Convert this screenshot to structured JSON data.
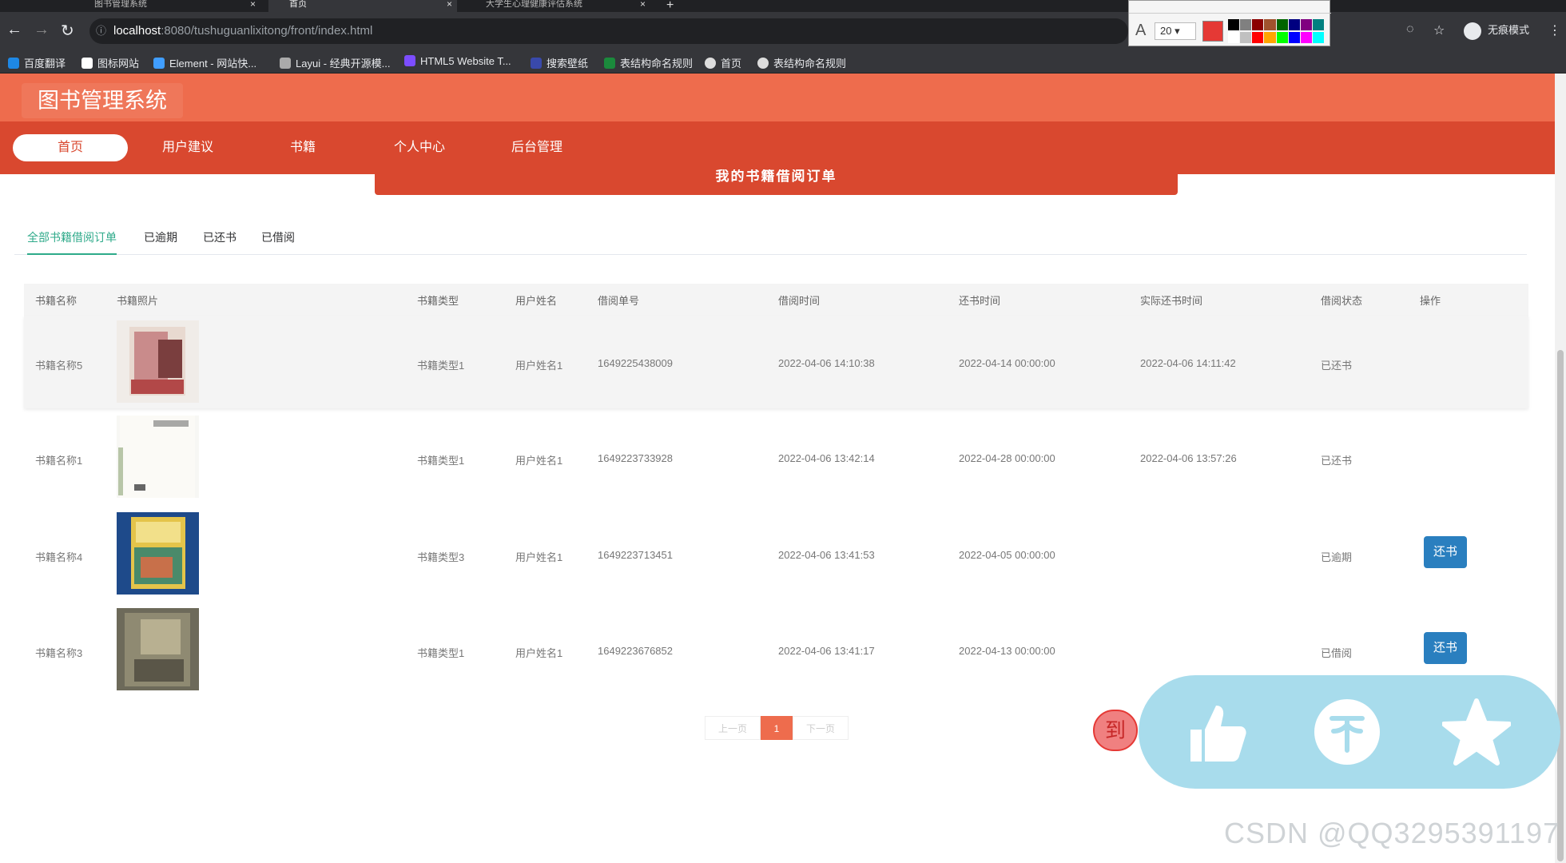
{
  "browser": {
    "tabs": [
      {
        "label": "图书管理系统",
        "active": false
      },
      {
        "label": "首页",
        "active": true
      },
      {
        "label": "大学生心理健康评估系统",
        "active": false
      }
    ],
    "url_host": "localhost",
    "url_path": ":8080/tushuguanlixitong/front/index.html",
    "incognito_label": "无痕模式",
    "font_size_value": "20",
    "bookmarks": [
      "百度翻译",
      "图标网站",
      "Element - 网站快...",
      "Layui - 经典开源模...",
      "HTML5 Website T...",
      "搜索壁纸",
      "表结构命名规则",
      "首页",
      "表结构命名规则"
    ]
  },
  "site": {
    "title": "图书管理系统",
    "nav": [
      "首页",
      "用户建议",
      "书籍",
      "个人中心",
      "后台管理"
    ],
    "active_nav": 0,
    "subtitle": "我的书籍借阅订单"
  },
  "order_tabs": [
    "全部书籍借阅订单",
    "已逾期",
    "已还书",
    "已借阅"
  ],
  "table": {
    "headers": [
      "书籍名称",
      "书籍照片",
      "书籍类型",
      "用户姓名",
      "借阅单号",
      "借阅时间",
      "还书时间",
      "实际还书时间",
      "借阅状态",
      "操作"
    ],
    "rows": [
      {
        "name": "书籍名称5",
        "type": "书籍类型1",
        "user": "用户姓名1",
        "order_no": "1649225438009",
        "borrow_time": "2022-04-06 14:10:38",
        "due_time": "2022-04-14 00:00:00",
        "actual_return": "2022-04-06 14:11:42",
        "status": "已还书",
        "action": ""
      },
      {
        "name": "书籍名称1",
        "type": "书籍类型1",
        "user": "用户姓名1",
        "order_no": "1649223733928",
        "borrow_time": "2022-04-06 13:42:14",
        "due_time": "2022-04-28 00:00:00",
        "actual_return": "2022-04-06 13:57:26",
        "status": "已还书",
        "action": ""
      },
      {
        "name": "书籍名称4",
        "type": "书籍类型3",
        "user": "用户姓名1",
        "order_no": "1649223713451",
        "borrow_time": "2022-04-06 13:41:53",
        "due_time": "2022-04-05 00:00:00",
        "actual_return": "",
        "status": "已逾期",
        "action": "还书"
      },
      {
        "name": "书籍名称3",
        "type": "书籍类型1",
        "user": "用户姓名1",
        "order_no": "1649223676852",
        "borrow_time": "2022-04-06 13:41:17",
        "due_time": "2022-04-13 00:00:00",
        "actual_return": "",
        "status": "已借阅",
        "action": "还书"
      }
    ]
  },
  "pager": {
    "prev": "上一页",
    "current": "1",
    "next": "下一页"
  },
  "float_badge": "到",
  "watermark": "CSDN @QQ3295391197",
  "colors": {
    "header": "#ee6c4d",
    "nav": "#d9482f",
    "accent": "#2eaa8a",
    "button": "#2a7fbf"
  }
}
